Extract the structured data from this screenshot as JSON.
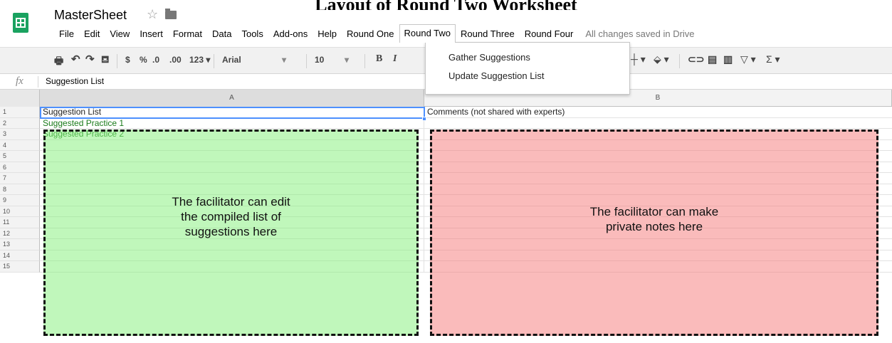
{
  "overlay_title": "Layout of Round Two Worksheet",
  "doc_title": "MasterSheet",
  "menu": [
    "File",
    "Edit",
    "View",
    "Insert",
    "Format",
    "Data",
    "Tools",
    "Add-ons",
    "Help",
    "Round One",
    "Round Two",
    "Round Three",
    "Round Four"
  ],
  "save_status": "All changes saved in Drive",
  "toolbar": {
    "currency": "$",
    "percent": "%",
    "decrease_decimal": ".0",
    "increase_decimal": ".00",
    "number_format": "123",
    "font": "Arial",
    "font_size": "10",
    "bold": "B",
    "italic": "I"
  },
  "formula_bar": {
    "fx": "fx",
    "value": "Suggestion List"
  },
  "round_two_menu": [
    "Gather Suggestions",
    "Update Suggestion List"
  ],
  "columns": [
    "A",
    "B"
  ],
  "rows": [
    "1",
    "2",
    "3",
    "4",
    "5",
    "6",
    "7",
    "8",
    "9",
    "10",
    "11",
    "12",
    "13",
    "14",
    "15"
  ],
  "cells": {
    "a1": "Suggestion List",
    "b1": "Comments (not shared with experts)",
    "a2": "Suggested Practice 1",
    "a3": "Suggested Practice 2"
  },
  "annotations": {
    "green_lines": [
      "The facilitator can edit",
      "the compiled list of",
      "suggestions here"
    ],
    "red_lines": [
      "The facilitator can make",
      "private notes here"
    ]
  },
  "colors": {
    "app_green": "#1aa260",
    "selection_blue": "#4d90fe",
    "green_box": "#82f078",
    "red_box": "#f57878"
  }
}
